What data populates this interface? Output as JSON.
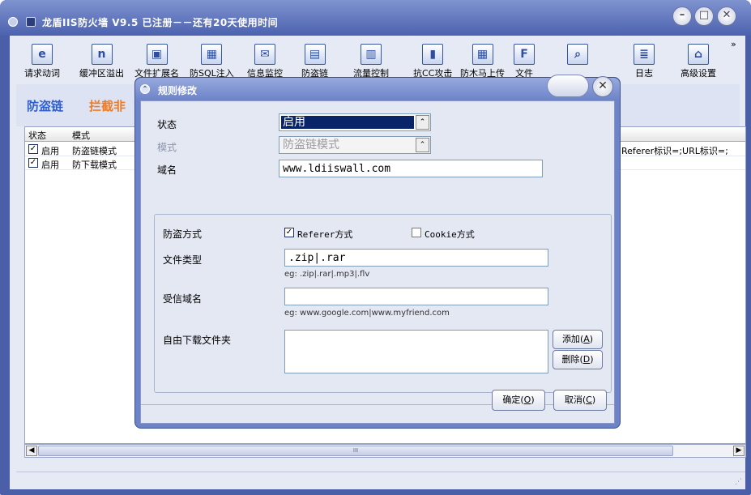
{
  "window": {
    "title": "龙盾IIS防火墙 V9.5 已注册－－还有20天使用时间"
  },
  "toolbar": [
    {
      "label": "请求动词",
      "icon": "verb-icon",
      "glyph": "e"
    },
    {
      "label": "缓冲区溢出",
      "icon": "buffer-icon",
      "glyph": "n"
    },
    {
      "label": "文件扩展名",
      "icon": "file-ext-icon",
      "glyph": "▣"
    },
    {
      "label": "防SQL注入",
      "icon": "sql-icon",
      "glyph": "▦"
    },
    {
      "label": "信息监控",
      "icon": "mail-icon",
      "glyph": "✉"
    },
    {
      "label": "防盗链",
      "icon": "hotlink-icon",
      "glyph": "▤"
    },
    {
      "label": "流量控制",
      "icon": "trash-icon",
      "glyph": "▥"
    },
    {
      "label": "抗CC攻击",
      "icon": "cc-icon",
      "glyph": "▮"
    },
    {
      "label": "防木马上传",
      "icon": "trojan-icon",
      "glyph": "▦"
    },
    {
      "label": "文件",
      "icon": "file-icon",
      "glyph": "F"
    },
    {
      "label": "",
      "icon": "magnifier-icon",
      "glyph": "⌕"
    },
    {
      "label": "日志",
      "icon": "log-icon",
      "glyph": "≣"
    },
    {
      "label": "高级设置",
      "icon": "house-icon",
      "glyph": "⌂"
    }
  ],
  "more": "»",
  "heading": {
    "primary": "防盗链",
    "secondary": "拦截非"
  },
  "table": {
    "headers": [
      "状态",
      "模式"
    ],
    "rows": [
      {
        "status": "启用",
        "mode": "防盗链模式",
        "tail": "Referer标识=;URL标识=;"
      },
      {
        "status": "启用",
        "mode": "防下载模式",
        "tail": ""
      }
    ]
  },
  "scroll": {
    "thumb": "III"
  },
  "dialog": {
    "title": "规则修改",
    "status_label": "状态",
    "status_value": "启用",
    "mode_label": "模式",
    "mode_value": "防盗链模式",
    "domain_label": "域名",
    "domain_value": "www.ldiiswall.com",
    "method_label": "防盗方式",
    "referer_label": "Referer方式",
    "referer_checked": true,
    "cookie_label": "Cookie方式",
    "cookie_checked": false,
    "filetype_label": "文件类型",
    "filetype_value": ".zip|.rar",
    "filetype_hint": "eg: .zip|.rar|.mp3|.flv",
    "trusted_label": "受信域名",
    "trusted_value": "",
    "trusted_hint": "eg: www.google.com|www.myfriend.com",
    "folder_label": "自由下载文件夹",
    "add_label": "添加",
    "add_key": "A",
    "delete_label": "删除",
    "delete_key": "D",
    "ok_label": "确定",
    "ok_key": "O",
    "cancel_label": "取消",
    "cancel_key": "C"
  }
}
